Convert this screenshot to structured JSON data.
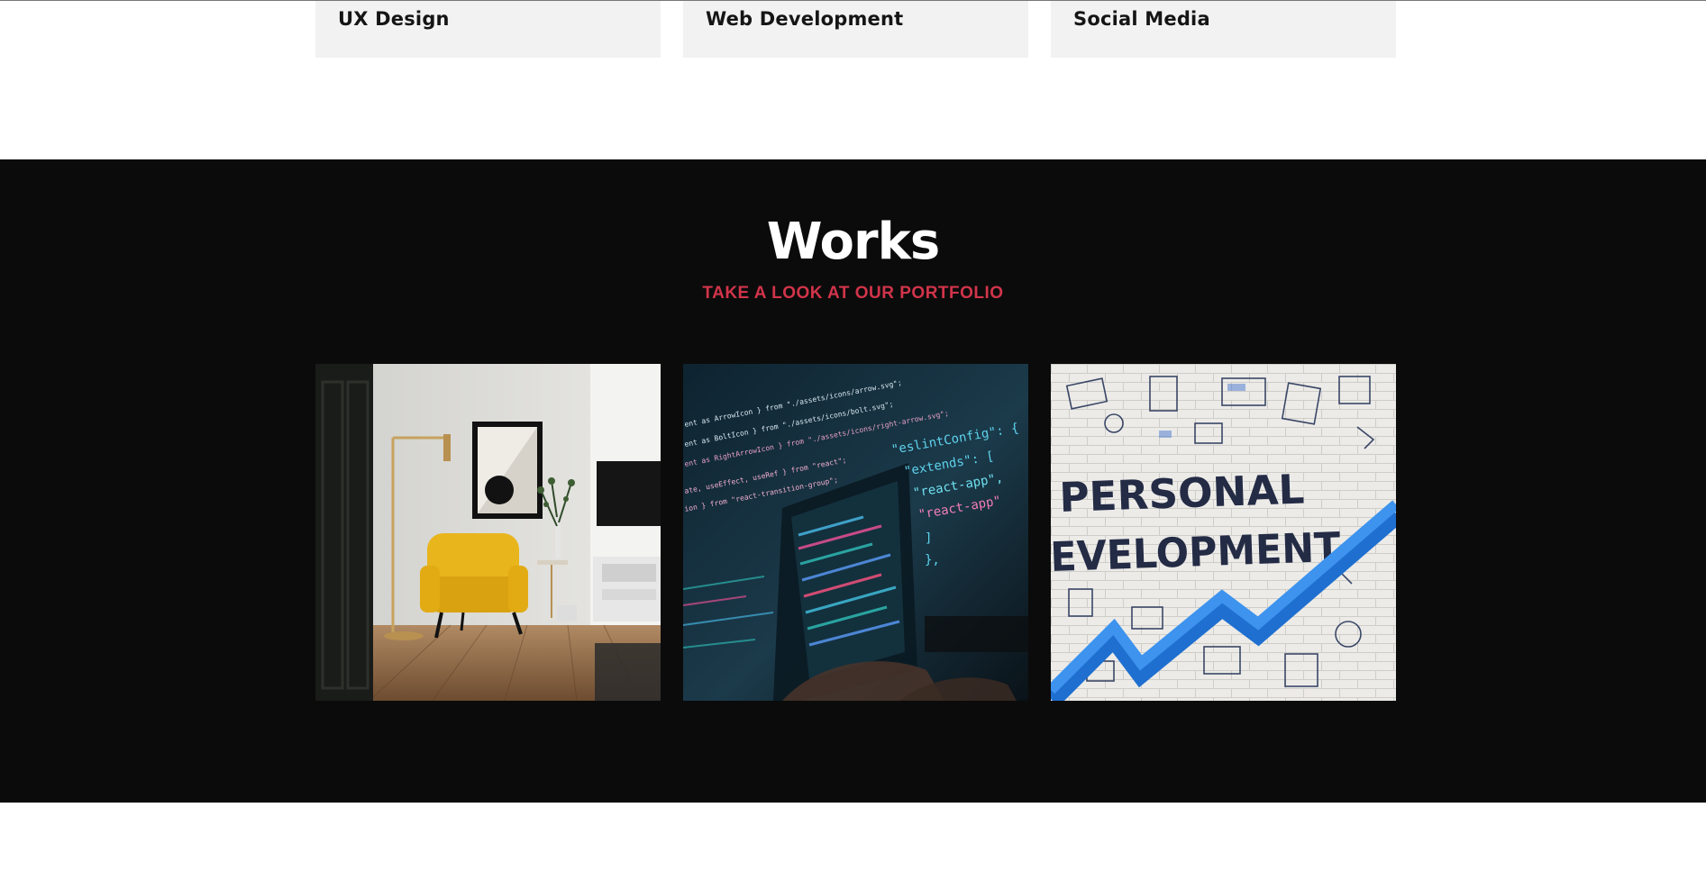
{
  "services": {
    "items": [
      {
        "title": "UX Design"
      },
      {
        "title": "Web Development"
      },
      {
        "title": "Social Media"
      }
    ]
  },
  "works": {
    "title": "Works",
    "subtitle": "TAKE A LOOK AT OUR PORTFOLIO",
    "accent_color": "#d1344a",
    "background_color": "#0b0b0b",
    "items": [
      {
        "image": "interior-yellow-armchair-photo"
      },
      {
        "image": "code-on-laptop-screen-photo",
        "code_lines_left": [
          "ent as ArrowIcon } from \"./assets/icons/arrow.svg\";",
          "ent as BoltIcon } from \"./assets/icons/bolt.svg\";",
          "ent as RightArrowIcon } from \"./assets/icons/right-arrow.svg\";",
          "ate, useEffect, useRef } from \"react\";",
          "ion } from \"react-transition-group\";"
        ],
        "code_lines_right": [
          "\"eslintConfig\": {",
          "\"extends\": [",
          "\"react-app\",",
          "\"react-app\""
        ],
        "code_brackets": [
          "]",
          "},"
        ]
      },
      {
        "image": "personal-development-brick-wall-photo",
        "wall_text": [
          "PERSONAL",
          "EVELOPMENT"
        ]
      }
    ]
  }
}
